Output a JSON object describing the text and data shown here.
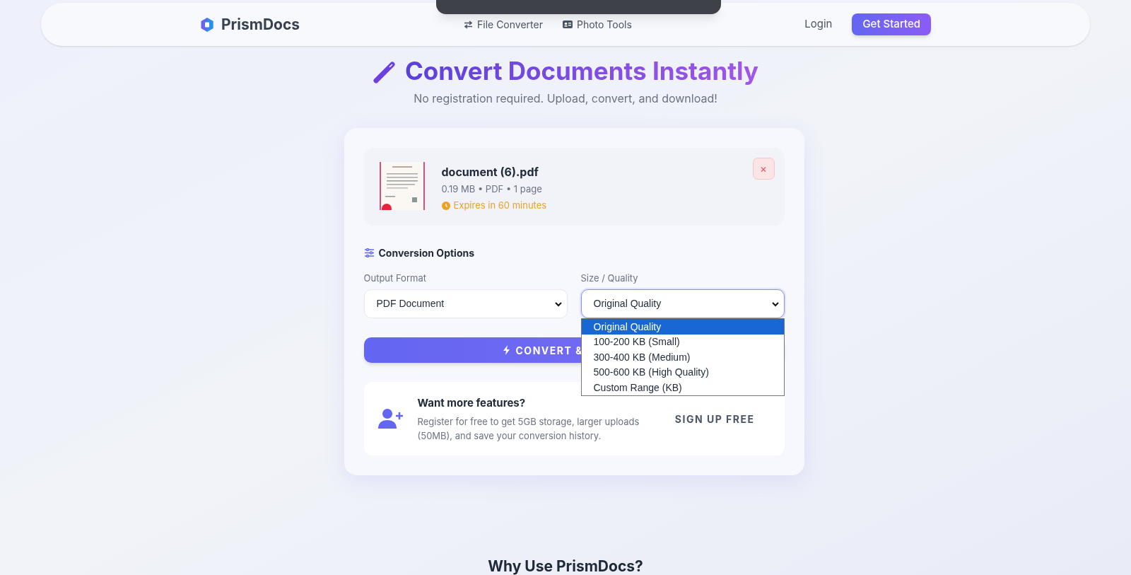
{
  "nav": {
    "brand": "PrismDocs",
    "links": [
      {
        "kind": "arrows",
        "label": "File Converter"
      },
      {
        "kind": "card",
        "label": "Photo Tools"
      }
    ],
    "login": "Login",
    "cta": "Get Started"
  },
  "hero": {
    "title": "Convert Documents Instantly",
    "subtitle": "No registration required. Upload, convert, and download!"
  },
  "file": {
    "name": "document (6).pdf",
    "meta": "0.19 MB • PDF • 1 page",
    "expiry": "Expires in 60 minutes",
    "remove": "×"
  },
  "options": {
    "title": "Conversion Options",
    "fields": [
      {
        "label": "Output Format",
        "value": "PDF Document",
        "open": false
      },
      {
        "label": "Size / Quality",
        "value": "Original Quality",
        "open": true,
        "options": [
          {
            "label": "Original Quality",
            "selected": true
          },
          {
            "label": "100-200 KB (Small)",
            "selected": false
          },
          {
            "label": "300-400 KB (Medium)",
            "selected": false
          },
          {
            "label": "500-600 KB (High Quality)",
            "selected": false
          },
          {
            "label": "Custom Range (KB)",
            "selected": false
          }
        ]
      }
    ]
  },
  "convert_button": "CONVERT &",
  "promo": {
    "title": "Want more features?",
    "text": "Register for free to get 5GB storage, larger uploads (50MB), and save your conversion history.",
    "button": "SIGN UP FREE"
  },
  "section_heading": "Why Use PrismDocs?"
}
